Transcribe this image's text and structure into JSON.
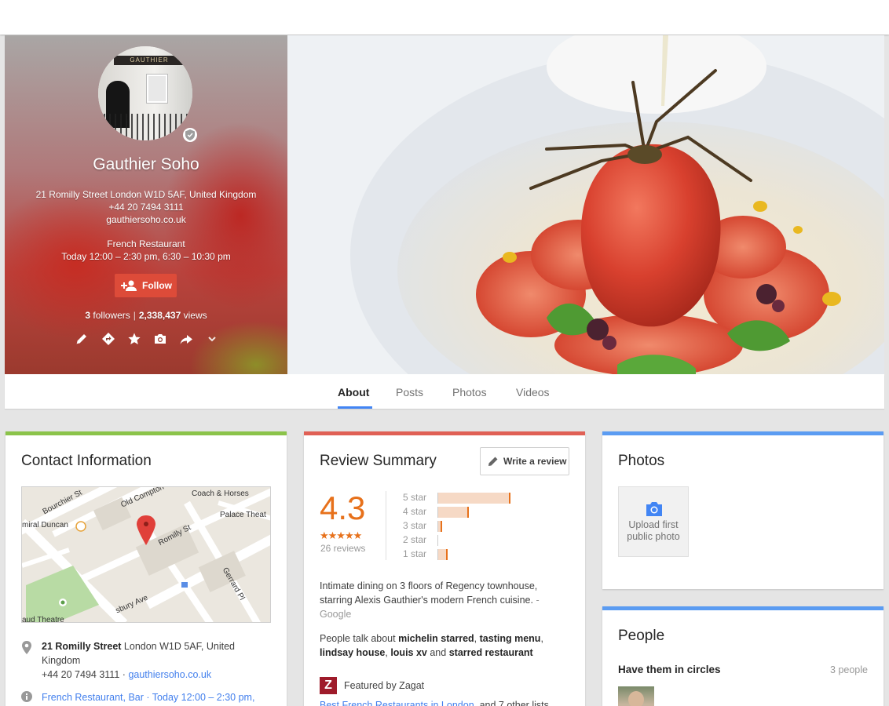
{
  "profile": {
    "name": "Gauthier Soho",
    "avatar_sign": "GAUTHIER",
    "address": "21 Romilly Street London W1D 5AF, United Kingdom",
    "phone": "+44 20 7494 3111",
    "website": "gauthiersoho.co.uk",
    "category": "French Restaurant",
    "hours": "Today 12:00 – 2:30 pm, 6:30 – 10:30 pm",
    "follow_label": "Follow",
    "followers_count": "3",
    "followers_label": "followers",
    "separator": "|",
    "views_count": "2,338,437",
    "views_label": "views",
    "actions": [
      "pencil-icon",
      "directions-icon",
      "star-icon",
      "camera-icon",
      "share-icon",
      "chevron-down-icon"
    ],
    "accent": "#dd4b39"
  },
  "tabs": [
    {
      "label": "About",
      "active": true
    },
    {
      "label": "Posts",
      "active": false
    },
    {
      "label": "Photos",
      "active": false
    },
    {
      "label": "Videos",
      "active": false
    }
  ],
  "contact": {
    "title": "Contact Information",
    "stripe": "#8bc34a",
    "map_labels": [
      "Bourchier St",
      "Old Compton",
      "Coach & Horses",
      "Palace Theat",
      "miral Duncan",
      "Romilly St",
      "Gerrard Pl",
      "sbury Ave",
      "aud Theatre"
    ],
    "street_bold": "21 Romilly Street",
    "address_rest": "London W1D 5AF, United Kingdom",
    "phone": "+44 20 7494 3111",
    "dot": "·",
    "website": "gauthiersoho.co.uk",
    "category_line": "French Restaurant, Bar · Today 12:00 – 2:30 pm,"
  },
  "review": {
    "title": "Review Summary",
    "stripe": "#e06055",
    "write_label": "Write a review",
    "rating": "4.3",
    "stars": "★★★★★",
    "count": "26 reviews",
    "bars": [
      {
        "label": "5 star",
        "value": 0.71
      },
      {
        "label": "4 star",
        "value": 0.3
      },
      {
        "label": "3 star",
        "value": 0.04
      },
      {
        "label": "2 star",
        "value": 0.0
      },
      {
        "label": "1 star",
        "value": 0.09
      }
    ],
    "description": "Intimate dining on 3 floors of Regency townhouse, starring Alexis Gauthier's modern French cuisine.",
    "description_source": "- Google",
    "talk_prefix": "People talk about",
    "talk_1": "michelin starred",
    "talk_sep1": ",",
    "talk_2": "tasting menu",
    "talk_sep2": ",",
    "talk_3": "lindsay house",
    "talk_sep3": ",",
    "talk_4": "louis xv",
    "talk_and": "and",
    "talk_5": "starred restaurant",
    "zagat_logo": "Z",
    "zagat_label": "Featured by Zagat",
    "zagat_list_link": "Best French Restaurants in London",
    "zagat_list_rest": ", and 7 other lists"
  },
  "photos": {
    "title": "Photos",
    "stripe": "#5b9cf2",
    "upload_label": "Upload first public photo"
  },
  "people": {
    "title": "People",
    "stripe": "#5b9cf2",
    "circles_label": "Have them in circles",
    "circles_count": "3 people"
  }
}
